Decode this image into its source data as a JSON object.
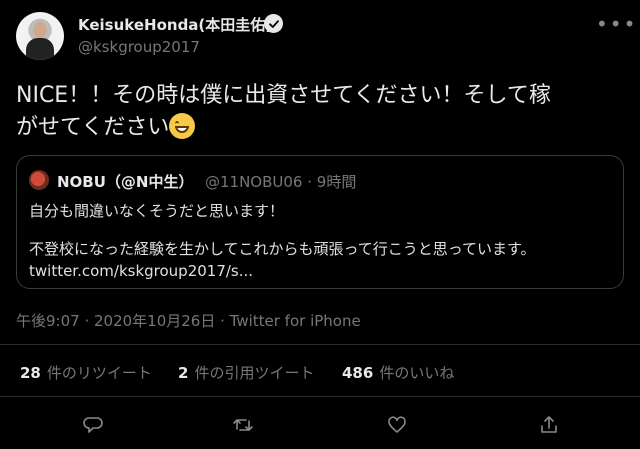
{
  "tweet": {
    "author_name": "KeisukeHonda(本田圭佑)",
    "author_handle": "@kskgroup2017",
    "text_line1": "NICE！！その時は僕に出資させてください！そして稼",
    "text_line2": "がせてください",
    "emoji": "grinning-face-with-smiling-eyes",
    "timestamp": "午後9:07 · 2020年10月26日 · Twitter for iPhone"
  },
  "quoted_tweet": {
    "author_name": "NOBU（@N中生）",
    "meta": "@11NOBU06 · 9時間",
    "line1": "自分も間違いなくそうだと思います！",
    "line2": "不登校になった経験を生かしてこれからも頑張って行こうと思っています。",
    "link": "twitter.com/kskgroup2017/s..."
  },
  "stats": {
    "retweets_count": "28",
    "retweets_label": "件のリツイート",
    "quotes_count": "2",
    "quotes_label": "件の引用ツイート",
    "likes_count": "486",
    "likes_label": "件のいいね"
  },
  "icons": [
    "verified-badge-icon",
    "more-options-icon",
    "reply-icon",
    "retweet-icon",
    "like-icon",
    "share-icon"
  ]
}
